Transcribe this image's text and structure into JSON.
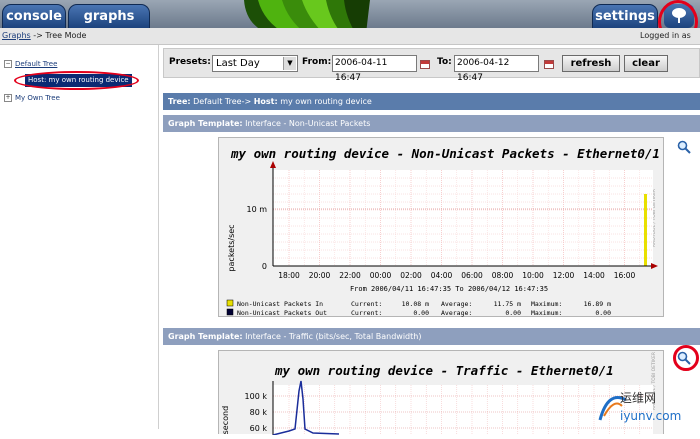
{
  "tabs": {
    "console": "console",
    "graphs": "graphs",
    "settings": "settings"
  },
  "breadcrumb": {
    "link": "Graphs",
    "separator": "->",
    "current": "Tree Mode"
  },
  "logged_in": "Logged in as",
  "tree": {
    "nodes": [
      {
        "label": "Default Tree",
        "toggle": "−"
      },
      {
        "label": "Host: my own routing device"
      },
      {
        "label": "My Own Tree",
        "toggle": "+"
      }
    ]
  },
  "filter": {
    "presets_label": "Presets:",
    "preset_value": "Last Day",
    "from_label": "From:",
    "from_value": "2006-04-11 16:47",
    "to_label": "To:",
    "to_value": "2006-04-12 16:47",
    "refresh_label": "refresh",
    "clear_label": "clear"
  },
  "tree_header": {
    "tree_label": "Tree:",
    "tree_value": "Default Tree->",
    "host_label": "Host:",
    "host_value": "my own routing device"
  },
  "graph1_header": {
    "label": "Graph Template:",
    "value": "Interface - Non-Unicast Packets"
  },
  "graph2_header": {
    "label": "Graph Template:",
    "value": "Interface - Traffic (bits/sec, Total Bandwidth)"
  },
  "graph1": {
    "title": "my own routing device - Non-Unicast Packets - Ethernet0/1",
    "ylabel": "packets/sec",
    "side_label": "RRDTOOL / TOBI OETIKER",
    "x_ticks": [
      "18:00",
      "20:00",
      "22:00",
      "00:00",
      "02:00",
      "04:00",
      "06:00",
      "08:00",
      "10:00",
      "12:00",
      "14:00",
      "16:00"
    ],
    "y_ticks": [
      "10 m",
      "0"
    ],
    "date_range": "From 2006/04/11 16:47:35 To 2006/04/12 16:47:35",
    "legend": [
      {
        "name": "Non-Unicast Packets In",
        "current": "Current:",
        "current_value": "10.08 m",
        "average": "Average:",
        "average_value": "11.75 m",
        "maximum": "Maximum:",
        "maximum_value": "16.89 m",
        "color": "#e8e000"
      },
      {
        "name": "Non-Unicast Packets Out",
        "current": "Current:",
        "current_value": "0.00",
        "average": "Average:",
        "average_value": "0.00",
        "maximum": "Maximum:",
        "maximum_value": "0.00",
        "color": "#000033"
      }
    ]
  },
  "graph2": {
    "title": "my own routing device - Traffic - Ethernet0/1",
    "ylabel": "r second",
    "side_label": "RRDTOOL / TOBI OETIKER",
    "y_ticks": [
      "100 k",
      "80 k",
      "60 k"
    ]
  },
  "watermark": {
    "line1": "运维网",
    "line2": "iyunv.com"
  },
  "colors": {
    "tab": "#1c437d",
    "tree_header": "#5a7cab",
    "template_header": "#8e9fbe",
    "highlight_ring": "#e3001b"
  }
}
